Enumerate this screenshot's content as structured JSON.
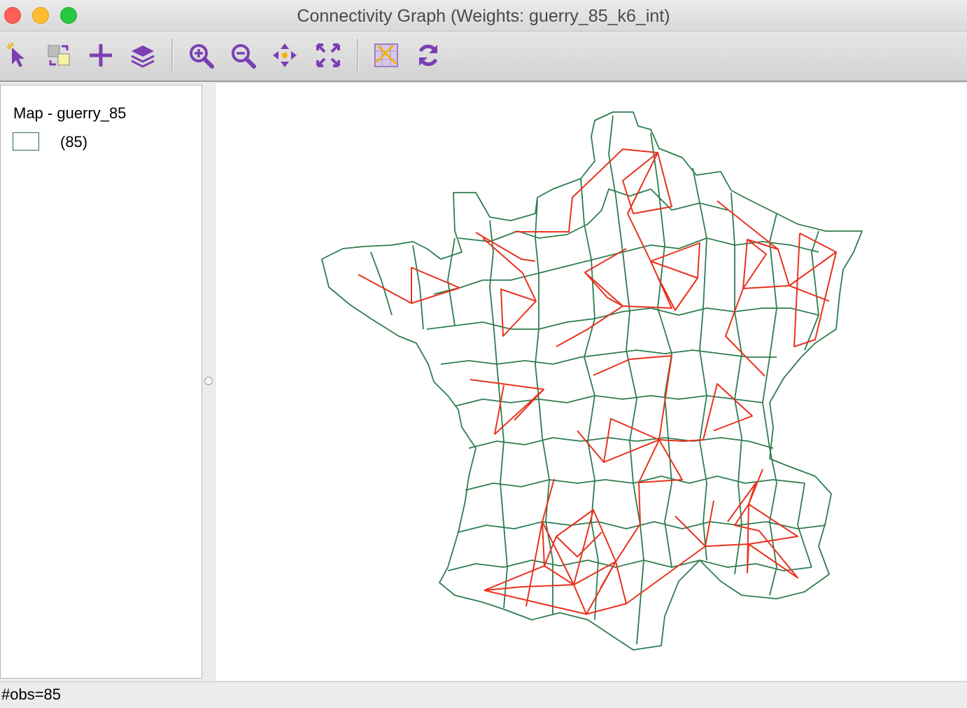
{
  "window": {
    "title": "Connectivity Graph (Weights: guerry_85_k6_int)"
  },
  "toolbar": {
    "accent_color": "#7b3fb3",
    "tools": [
      {
        "icon": "select-arrow-icon"
      },
      {
        "icon": "selection-options-icon"
      },
      {
        "icon": "add-layer-plus-icon"
      },
      {
        "icon": "layers-icon"
      },
      {
        "icon": "zoom-in-icon"
      },
      {
        "icon": "zoom-out-icon"
      },
      {
        "icon": "pan-icon"
      },
      {
        "icon": "full-extent-icon"
      },
      {
        "icon": "basemap-icon"
      },
      {
        "icon": "refresh-icon"
      }
    ]
  },
  "legend": {
    "title": "Map - guerry_85",
    "category_label": "(85)",
    "outline_color": "#2e6b45"
  },
  "map": {
    "boundary_color": "#2e7d4f",
    "graph_edge_color": "#e8321e"
  },
  "status": {
    "text": "#obs=85"
  }
}
